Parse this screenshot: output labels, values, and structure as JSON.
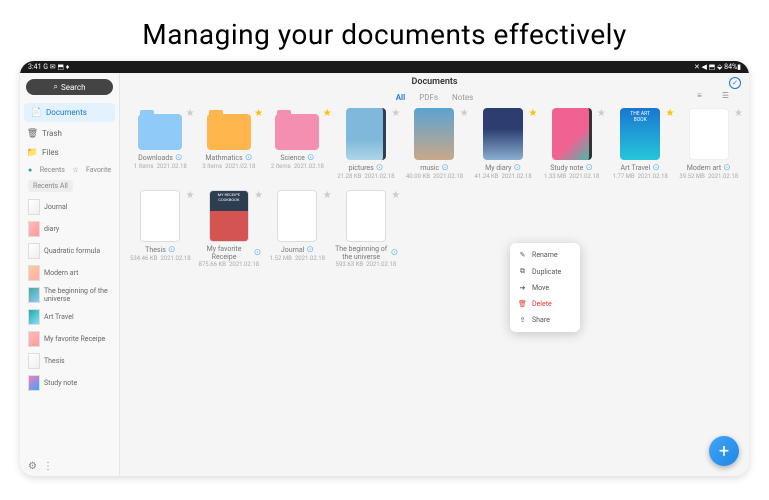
{
  "hero": {
    "title": "Managing your documents effectively"
  },
  "status": {
    "time": "3:41",
    "icons_left": "G ✉ ⬒ ♦",
    "icons_right": "✕ ◀ ⬒ ⬙ 84%▮"
  },
  "sidebar": {
    "search": "Search",
    "nav": [
      {
        "icon": "📄",
        "label": "Documents",
        "active": true
      },
      {
        "icon": "🗑",
        "label": "Trash",
        "active": false
      },
      {
        "icon": "📁",
        "label": "Files",
        "active": false
      }
    ],
    "section": {
      "recents": "Recents",
      "favorite": "Favorite"
    },
    "tabs": {
      "all": "Recents All"
    },
    "recents": [
      {
        "label": "Journal",
        "cls": ""
      },
      {
        "label": "diary",
        "cls": "c2"
      },
      {
        "label": "Quadratic formula",
        "cls": ""
      },
      {
        "label": "Modern art",
        "cls": "c6"
      },
      {
        "label": "The beginning of the universe",
        "cls": "c3"
      },
      {
        "label": "Art Travel",
        "cls": "c5"
      },
      {
        "label": "My favorite Receipe",
        "cls": "c2"
      },
      {
        "label": "Thesis",
        "cls": ""
      },
      {
        "label": "Study note",
        "cls": "c4"
      }
    ]
  },
  "content": {
    "title": "Documents",
    "tabs": {
      "all": "All",
      "pdfs": "PDFs",
      "notes": "Notes"
    },
    "row1": [
      {
        "name": "Downloads",
        "size": "1 items",
        "date": "2021.02.18",
        "star": false,
        "kind": "folder blue"
      },
      {
        "name": "Mathmatics",
        "size": "3 items",
        "date": "2021.02.18",
        "star": true,
        "kind": "folder orange"
      },
      {
        "name": "Science",
        "size": "2 items",
        "date": "2021.02.18",
        "star": true,
        "kind": "folder pink"
      },
      {
        "name": "pictures",
        "size": "21.28 KB",
        "date": "2021.02.18",
        "star": false,
        "kind": "note pictures"
      },
      {
        "name": "music",
        "size": "40.00 KB",
        "date": "2021.02.18",
        "star": false,
        "kind": "note music"
      },
      {
        "name": "My diary",
        "size": "41.24 KB",
        "date": "2021.02.18",
        "star": true,
        "kind": "note diary"
      },
      {
        "name": "Study note",
        "size": "1.33 MB",
        "date": "2021.02.18",
        "star": false,
        "kind": "note study"
      },
      {
        "name": "Art Travel",
        "size": "1.77 MB",
        "date": "2021.02.18",
        "star": true,
        "kind": "note art",
        "text": "THE ART BOOK"
      },
      {
        "name": "Modern art",
        "size": "39.52 MB",
        "date": "2021.02.18",
        "star": false,
        "kind": "note modern"
      }
    ],
    "row2": [
      {
        "name": "Thesis",
        "size": "534.46 KB",
        "date": "2021.02.18",
        "star": false,
        "kind": "doc"
      },
      {
        "name": "My favorite Receipe",
        "size": "875.66 KB",
        "date": "2021.02.18",
        "star": false,
        "kind": "doc recipe",
        "text": "MY RECEIPE COOKBOOK"
      },
      {
        "name": "Journal",
        "size": "1.52 MB",
        "date": "2021.02.18",
        "star": false,
        "kind": "doc"
      },
      {
        "name": "The beginning of the universe",
        "size": "593.63 KB",
        "date": "2021.02.18",
        "star": false,
        "kind": "doc"
      }
    ]
  },
  "menu": [
    {
      "icon": "✎",
      "label": "Rename",
      "danger": false
    },
    {
      "icon": "⧉",
      "label": "Duplicate",
      "danger": false
    },
    {
      "icon": "➔",
      "label": "Move",
      "danger": false
    },
    {
      "icon": "🗑",
      "label": "Delete",
      "danger": true
    },
    {
      "icon": "⇪",
      "label": "Share",
      "danger": false
    }
  ]
}
